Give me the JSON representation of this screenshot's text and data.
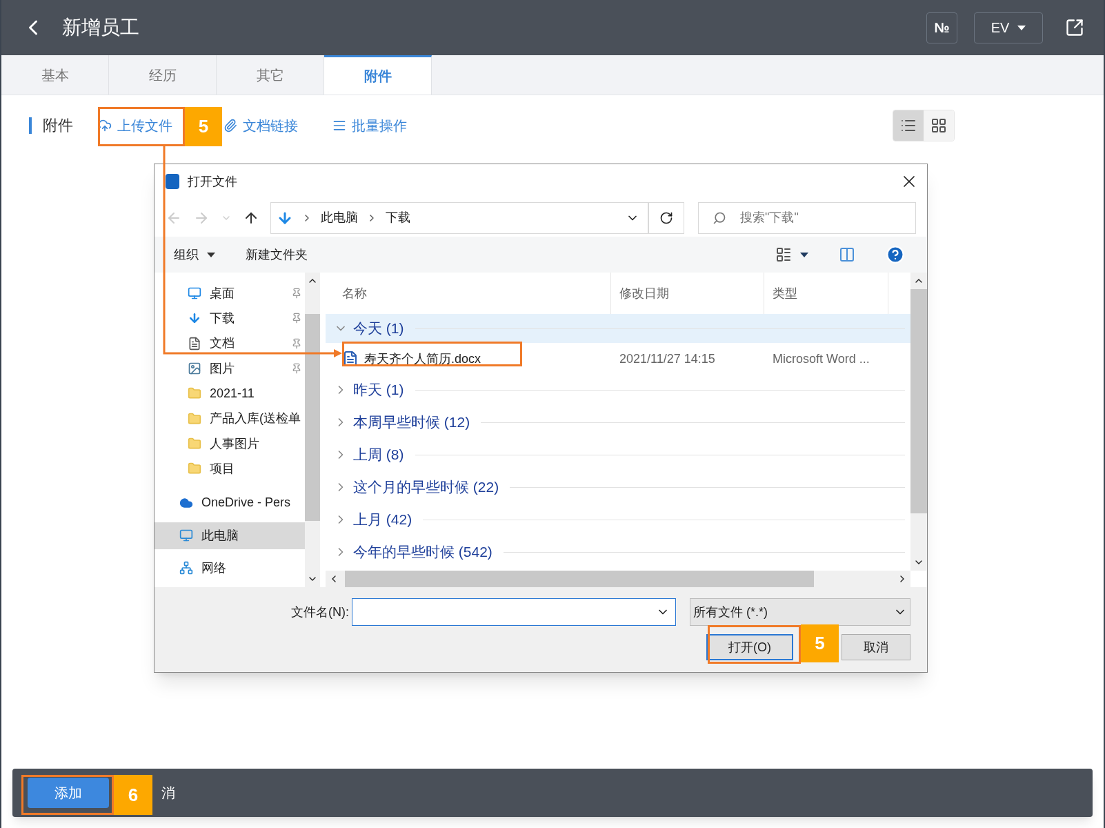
{
  "header": {
    "title": "新增员工",
    "buttons": [
      "№",
      "EV"
    ]
  },
  "tabs": [
    {
      "label": "基本",
      "selected": false
    },
    {
      "label": "经历",
      "selected": false
    },
    {
      "label": "其它",
      "selected": false
    },
    {
      "label": "附件",
      "selected": true
    }
  ],
  "toolbar": {
    "title": "附件",
    "actions": [
      {
        "kind": "upload",
        "label": "上传文件"
      },
      {
        "kind": "link",
        "label": "文档链接"
      },
      {
        "kind": "batch",
        "label": "批量操作"
      }
    ],
    "views": [
      {
        "kind": "list",
        "selected": true
      },
      {
        "kind": "grid",
        "selected": false
      }
    ]
  },
  "dialog": {
    "title": "打开文件",
    "breadcrumb": [
      "此电脑",
      "下载"
    ],
    "search": {
      "placeholder": "搜索\"下载\""
    },
    "commands": [
      "组织",
      "新建文件夹"
    ],
    "quick_access": [
      {
        "label": "桌面",
        "kind": "desktop",
        "pinned": true
      },
      {
        "label": "下载",
        "kind": "download",
        "pinned": true
      },
      {
        "label": "文档",
        "kind": "document",
        "pinned": true
      },
      {
        "label": "图片",
        "kind": "picture",
        "pinned": true
      },
      {
        "label": "2021-11",
        "kind": "folder",
        "pinned": false
      },
      {
        "label": "产品入库(送检单",
        "kind": "folder",
        "pinned": false
      },
      {
        "label": "人事图片",
        "kind": "folder",
        "pinned": false
      },
      {
        "label": "项目",
        "kind": "folder",
        "pinned": false
      }
    ],
    "locations": [
      {
        "label": "OneDrive - Pers",
        "kind": "cloud",
        "selected": false
      },
      {
        "label": "此电脑",
        "kind": "computer",
        "selected": true
      },
      {
        "label": "网络",
        "kind": "network",
        "selected": false
      }
    ],
    "columns": [
      "名称",
      "修改日期",
      "类型"
    ],
    "groups": [
      {
        "label": "今天 (1)",
        "expanded": true,
        "selected": true,
        "files": [
          {
            "name": "寿天齐个人简历.docx",
            "date": "2021/11/27 14:15",
            "type": "Microsoft Word ..."
          }
        ]
      },
      {
        "label": "昨天 (1)",
        "expanded": false,
        "selected": false
      },
      {
        "label": "本周早些时候 (12)",
        "expanded": false,
        "selected": false
      },
      {
        "label": "上周 (8)",
        "expanded": false,
        "selected": false
      },
      {
        "label": "这个月的早些时候 (22)",
        "expanded": false,
        "selected": false
      },
      {
        "label": "上月 (42)",
        "expanded": false,
        "selected": false
      },
      {
        "label": "今年的早些时候 (542)",
        "expanded": false,
        "selected": false
      }
    ],
    "filename_label": "文件名(N):",
    "filetype": "所有文件 (*.*)",
    "buttons": [
      "打开(O)",
      "取消"
    ]
  },
  "footer": {
    "primary": "添加",
    "secondary": "消"
  },
  "step_badges": [
    "5",
    "5",
    "6"
  ]
}
